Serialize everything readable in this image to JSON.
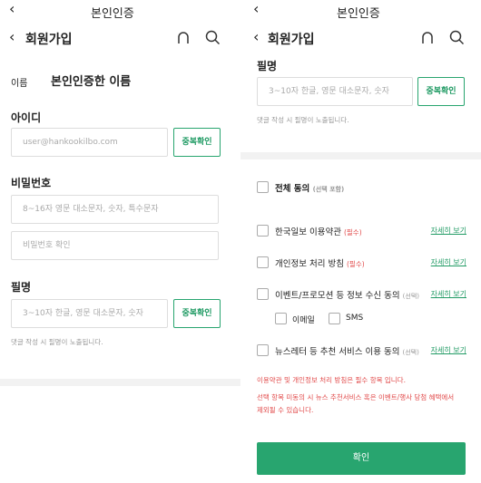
{
  "left": {
    "status_title": "본인인증",
    "nav_title": "회원가입",
    "name_label": "이름",
    "name_value": "본인인증한 이름",
    "id_label": "아이디",
    "id_placeholder": "user@hankookilbo.com",
    "dup_check": "중복확인",
    "password_label": "비밀번호",
    "password_placeholder": "8~16자 영문 대소문자, 숫자, 특수문자",
    "password_confirm_placeholder": "비밀번호 확인",
    "nickname_label": "필명",
    "nickname_placeholder": "3~10자 한글, 영문 대소문자, 숫자",
    "nickname_dup_check": "중복확인",
    "nickname_hint": "댓글 작성 시 필명이 노출됩니다."
  },
  "right": {
    "status_title": "본인인증",
    "nav_title": "회원가입",
    "nickname_label": "필명",
    "nickname_placeholder": "3~10자 한글, 영문 대소문자, 숫자",
    "dup_check": "중복확인",
    "nickname_hint": "댓글 작성 시 필명이 노출됩니다.",
    "agree_all": "전체 동의",
    "agree_all_note": "(선택 포함)",
    "terms": [
      {
        "label": "한국일보 이용약관",
        "tag": "(필수)",
        "tag_type": "req",
        "detail": "자세히 보기"
      },
      {
        "label": "개인정보 처리 방침",
        "tag": "(필수)",
        "tag_type": "req",
        "detail": "자세히 보기"
      },
      {
        "label": "이벤트/프로모션 등 정보 수신 동의",
        "tag": "(선택)",
        "tag_type": "opt",
        "detail": "자세히 보기"
      },
      {
        "label": "뉴스레터 등 추천 서비스 이용 동의",
        "tag": "(선택)",
        "tag_type": "opt",
        "detail": "자세히 보기"
      }
    ],
    "channel_email": "이메일",
    "channel_sms": "SMS",
    "notice_1": "이용약관 및 개인정보 처리 방침은 필수 항목 입니다.",
    "notice_2": "선택 항목 미동의 시 뉴스 추천서비스 혹은 이벤트/행사 당첨 혜택에서",
    "notice_3": "제외될 수 있습니다.",
    "confirm": "확인"
  },
  "icons": {
    "back": "chevron-left-icon",
    "home": "home-arch-icon",
    "search": "search-icon"
  },
  "colors": {
    "accent": "#28a56f",
    "required": "#e24b4b"
  }
}
